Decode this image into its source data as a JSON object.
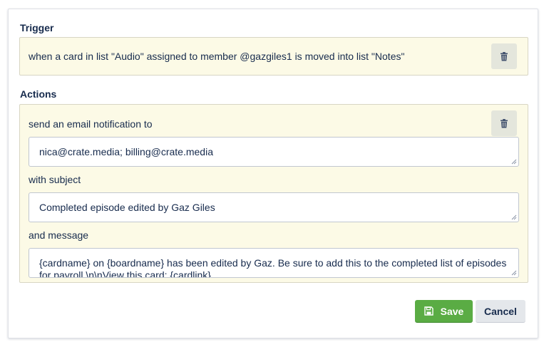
{
  "trigger": {
    "heading": "Trigger",
    "text": "when a card in list \"Audio\" assigned to member @gazgiles1 is moved into list \"Notes\"",
    "delete_icon": "trash-icon"
  },
  "actions": {
    "heading": "Actions",
    "intro": "send an email notification to",
    "recipients": "nica@crate.media; billing@crate.media",
    "subject_label": "with subject",
    "subject": "Completed episode edited by Gaz Giles",
    "message_label": "and message",
    "message": "{cardname} on {boardname} has been edited by Gaz. Be sure to add this to the completed list of episodes for payroll.\\n\\nView this card: {cardlink}",
    "delete_icon": "trash-icon"
  },
  "footer": {
    "save_label": "Save",
    "cancel_label": "Cancel",
    "save_icon": "floppy-disk-icon"
  },
  "colors": {
    "panel_bg": "#fcfae6",
    "save_green": "#5aac44",
    "text": "#172b4d"
  }
}
